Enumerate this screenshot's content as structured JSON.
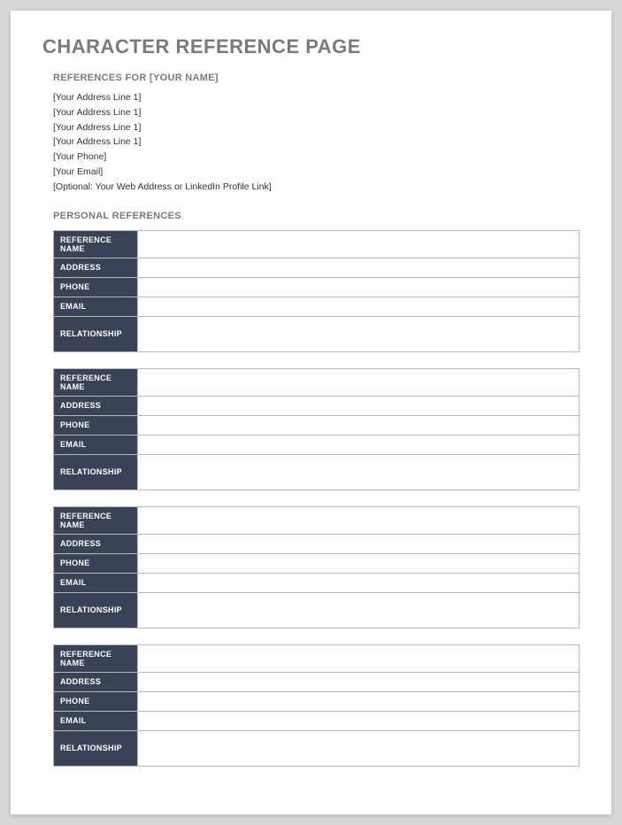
{
  "page_title": "CHARACTER REFERENCE PAGE",
  "references_for_header": "REFERENCES FOR [YOUR NAME]",
  "info_lines": [
    "[Your Address Line 1]",
    "[Your Address Line 1]",
    "[Your Address Line 1]",
    "[Your Address Line 1]",
    "[Your Phone]",
    "[Your Email]",
    "[Optional: Your Web Address or LinkedIn Profile Link]"
  ],
  "personal_references_header": "PERSONAL REFERENCES",
  "ref_labels": {
    "name": "REFERENCE NAME",
    "address": "ADDRESS",
    "phone": "PHONE",
    "email": "EMAIL",
    "relationship": "RELATIONSHIP"
  },
  "references": [
    {
      "name": "",
      "address": "",
      "phone": "",
      "email": "",
      "relationship": ""
    },
    {
      "name": "",
      "address": "",
      "phone": "",
      "email": "",
      "relationship": ""
    },
    {
      "name": "",
      "address": "",
      "phone": "",
      "email": "",
      "relationship": ""
    },
    {
      "name": "",
      "address": "",
      "phone": "",
      "email": "",
      "relationship": ""
    }
  ]
}
